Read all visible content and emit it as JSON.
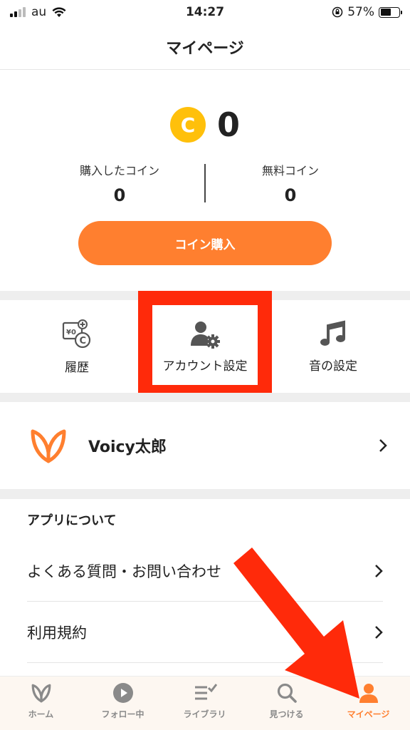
{
  "status_bar": {
    "carrier": "au",
    "time": "14:27",
    "battery": "57%",
    "battery_level": 0.57
  },
  "header": {
    "title": "マイページ"
  },
  "coins": {
    "icon_letter": "C",
    "total": "0",
    "purchased_label": "購入したコイン",
    "purchased_value": "0",
    "free_label": "無料コイン",
    "free_value": "0",
    "buy_button": "コイン購入"
  },
  "quick_menu": [
    {
      "label": "履歴",
      "icon": "history-coin-icon"
    },
    {
      "label": "アカウント設定",
      "icon": "account-settings-icon"
    },
    {
      "label": "音の設定",
      "icon": "music-note-icon"
    }
  ],
  "profile": {
    "name": "Voicy太郎"
  },
  "about": {
    "heading": "アプリについて",
    "items": [
      {
        "label": "よくある質問・お問い合わせ"
      },
      {
        "label": "利用規約"
      }
    ]
  },
  "tabs": [
    {
      "label": "ホーム",
      "icon": "voicy-v-icon"
    },
    {
      "label": "フォロー中",
      "icon": "play-icon"
    },
    {
      "label": "ライブラリ",
      "icon": "library-icon"
    },
    {
      "label": "見つける",
      "icon": "search-icon"
    },
    {
      "label": "マイページ",
      "icon": "person-icon",
      "active": true
    }
  ],
  "colors": {
    "accent": "#ff7f2f",
    "coin": "#ffc00b",
    "annotation": "#ff2a0a",
    "tab_bar_bg": "#fdf7f1"
  }
}
